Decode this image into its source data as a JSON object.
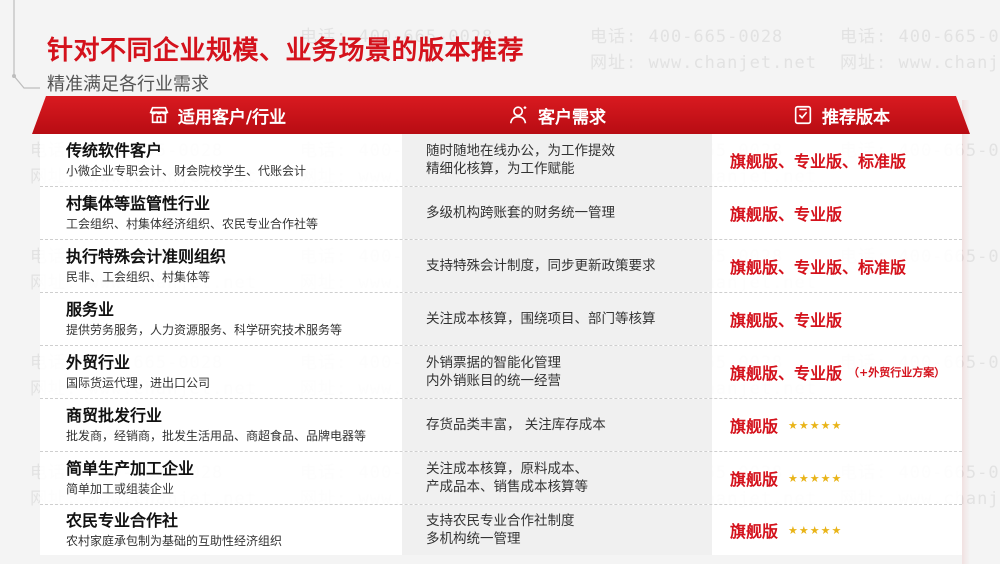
{
  "title": "针对不同企业规模、业务场景的版本推荐",
  "subtitle": "精准满足各行业需求",
  "watermark": {
    "phone": "电话: 400-665-0028",
    "site": "网址: www.chanjet.net"
  },
  "header": {
    "col1": "适用客户/行业",
    "col2": "客户需求",
    "col3": "推荐版本",
    "col1_icon": "store-icon",
    "col2_icon": "user-icon",
    "col3_icon": "checklist-icon"
  },
  "colors": {
    "accent": "#d4121c",
    "star": "#e9b418"
  },
  "rows": [
    {
      "name": "传统软件客户",
      "desc": "小微企业专职会计、财会院校学生、代账会计",
      "req1": "随时随地在线办公，为工作提效",
      "req2": "精细化核算，为工作赋能",
      "rec": "旗舰版、专业版、标准版",
      "note": "",
      "stars": ""
    },
    {
      "name": "村集体等监管性行业",
      "desc": "工会组织、村集体经济组织、农民专业合作社等",
      "req1": "多级机构跨账套的财务统一管理",
      "req2": "",
      "rec": "旗舰版、专业版",
      "note": "",
      "stars": ""
    },
    {
      "name": "执行特殊会计准则组织",
      "desc": "民非、工会组织、村集体等",
      "req1": "支持特殊会计制度，同步更新政策要求",
      "req2": "",
      "rec": "旗舰版、专业版、标准版",
      "note": "",
      "stars": ""
    },
    {
      "name": "服务业",
      "desc": "提供劳务服务，人力资源服务、科学研究技术服务等",
      "req1": "关注成本核算，围绕项目、部门等核算",
      "req2": "",
      "rec": "旗舰版、专业版",
      "note": "",
      "stars": ""
    },
    {
      "name": "外贸行业",
      "desc": "国际货运代理，进出口公司",
      "req1": "外销票据的智能化管理",
      "req2": "内外销账目的统一经营",
      "rec": "旗舰版、专业版",
      "note": "（+外贸行业方案）",
      "stars": ""
    },
    {
      "name": "商贸批发行业",
      "desc": "批发商，经销商，批发生活用品、商超食品、品牌电器等",
      "req1": "存货品类丰富， 关注库存成本",
      "req2": "",
      "rec": "旗舰版",
      "note": "",
      "stars": "★★★★★"
    },
    {
      "name": "简单生产加工企业",
      "desc": "简单加工或组装企业",
      "req1": "关注成本核算，原料成本、",
      "req2": "产成品本、销售成本核算等",
      "rec": "旗舰版",
      "note": "",
      "stars": "★★★★★"
    },
    {
      "name": "农民专业合作社",
      "desc": "农村家庭承包制为基础的互助性经济组织",
      "req1": "支持农民专业合作社制度",
      "req2": "多机构统一管理",
      "rec": "旗舰版",
      "note": "",
      "stars": "★★★★★"
    }
  ]
}
